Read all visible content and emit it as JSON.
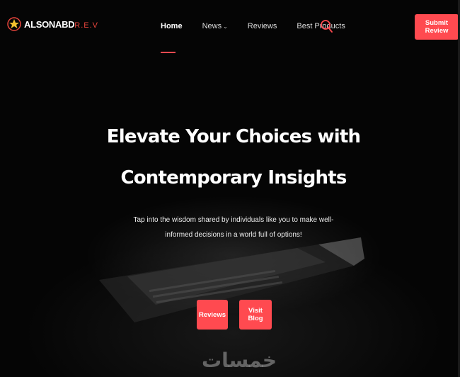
{
  "brand": {
    "logo_main": "ALSONABD",
    "logo_accent": "R.E.V",
    "accent_color": "#ff4a50"
  },
  "nav": {
    "items": [
      {
        "label": "Home",
        "active": true
      },
      {
        "label": "News",
        "has_dropdown": true
      },
      {
        "label": "Reviews"
      },
      {
        "label": "Best Products"
      }
    ],
    "search_icon": "search-icon"
  },
  "header": {
    "submit_label": "Submit Review"
  },
  "hero": {
    "title_line1": "Elevate Your Choices with",
    "title_line2": "Contemporary Insights",
    "subtitle": "Tap into the wisdom shared by individuals like you to make well-informed decisions in a world full of options!",
    "buttons": {
      "reviews": "Reviews",
      "blog": "Visit Blog"
    }
  },
  "watermark": "خمسات"
}
